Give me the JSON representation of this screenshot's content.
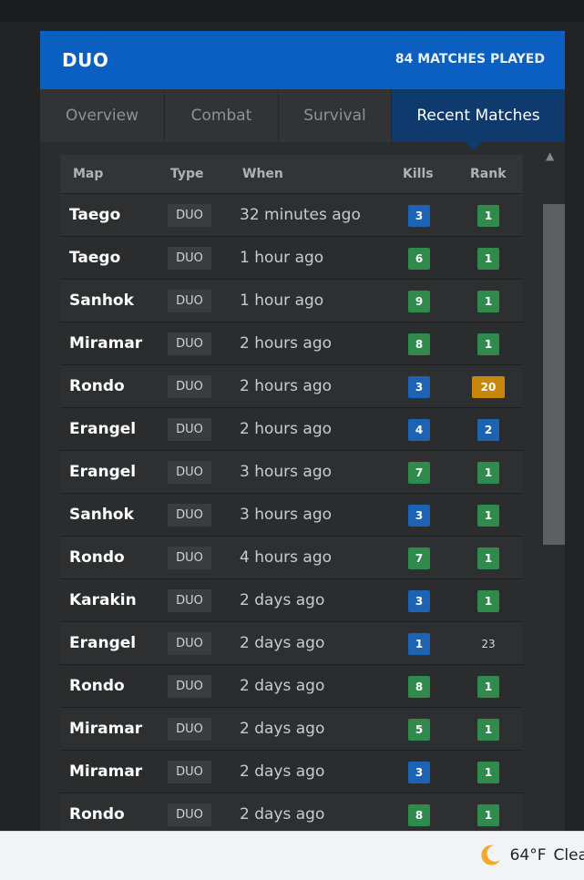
{
  "header": {
    "mode": "DUO",
    "matches_played": "84 MATCHES PLAYED"
  },
  "tabs": [
    {
      "label": "Overview",
      "active": false
    },
    {
      "label": "Combat",
      "active": false
    },
    {
      "label": "Survival",
      "active": false
    },
    {
      "label": "Recent Matches",
      "active": true
    }
  ],
  "table": {
    "columns": {
      "map": "Map",
      "type": "Type",
      "when": "When",
      "kills": "Kills",
      "rank": "Rank"
    },
    "rows": [
      {
        "map": "Taego",
        "type": "DUO",
        "when": "32 minutes ago",
        "kills": "3",
        "rank": "1"
      },
      {
        "map": "Taego",
        "type": "DUO",
        "when": "1 hour ago",
        "kills": "6",
        "rank": "1"
      },
      {
        "map": "Sanhok",
        "type": "DUO",
        "when": "1 hour ago",
        "kills": "9",
        "rank": "1"
      },
      {
        "map": "Miramar",
        "type": "DUO",
        "when": "2 hours ago",
        "kills": "8",
        "rank": "1"
      },
      {
        "map": "Rondo",
        "type": "DUO",
        "when": "2 hours ago",
        "kills": "3",
        "rank": "20"
      },
      {
        "map": "Erangel",
        "type": "DUO",
        "when": "2 hours ago",
        "kills": "4",
        "rank": "2"
      },
      {
        "map": "Erangel",
        "type": "DUO",
        "when": "3 hours ago",
        "kills": "7",
        "rank": "1"
      },
      {
        "map": "Sanhok",
        "type": "DUO",
        "when": "3 hours ago",
        "kills": "3",
        "rank": "1"
      },
      {
        "map": "Rondo",
        "type": "DUO",
        "when": "4 hours ago",
        "kills": "7",
        "rank": "1"
      },
      {
        "map": "Karakin",
        "type": "DUO",
        "when": "2 days ago",
        "kills": "3",
        "rank": "1"
      },
      {
        "map": "Erangel",
        "type": "DUO",
        "when": "2 days ago",
        "kills": "1",
        "rank": "23"
      },
      {
        "map": "Rondo",
        "type": "DUO",
        "when": "2 days ago",
        "kills": "8",
        "rank": "1"
      },
      {
        "map": "Miramar",
        "type": "DUO",
        "when": "2 days ago",
        "kills": "5",
        "rank": "1"
      },
      {
        "map": "Miramar",
        "type": "DUO",
        "when": "2 days ago",
        "kills": "3",
        "rank": "1"
      },
      {
        "map": "Rondo",
        "type": "DUO",
        "when": "2 days ago",
        "kills": "8",
        "rank": "1"
      }
    ]
  },
  "taskbar": {
    "weather_temp": "64°F",
    "weather_text": "Clea",
    "weather_icon": "moon-icon"
  },
  "colors": {
    "header_blue": "#0b5fc1",
    "active_tab": "#0f3a6e",
    "badge_blue": "#1d63b3",
    "badge_green": "#2f8a4c",
    "badge_orange": "#c9860d"
  }
}
